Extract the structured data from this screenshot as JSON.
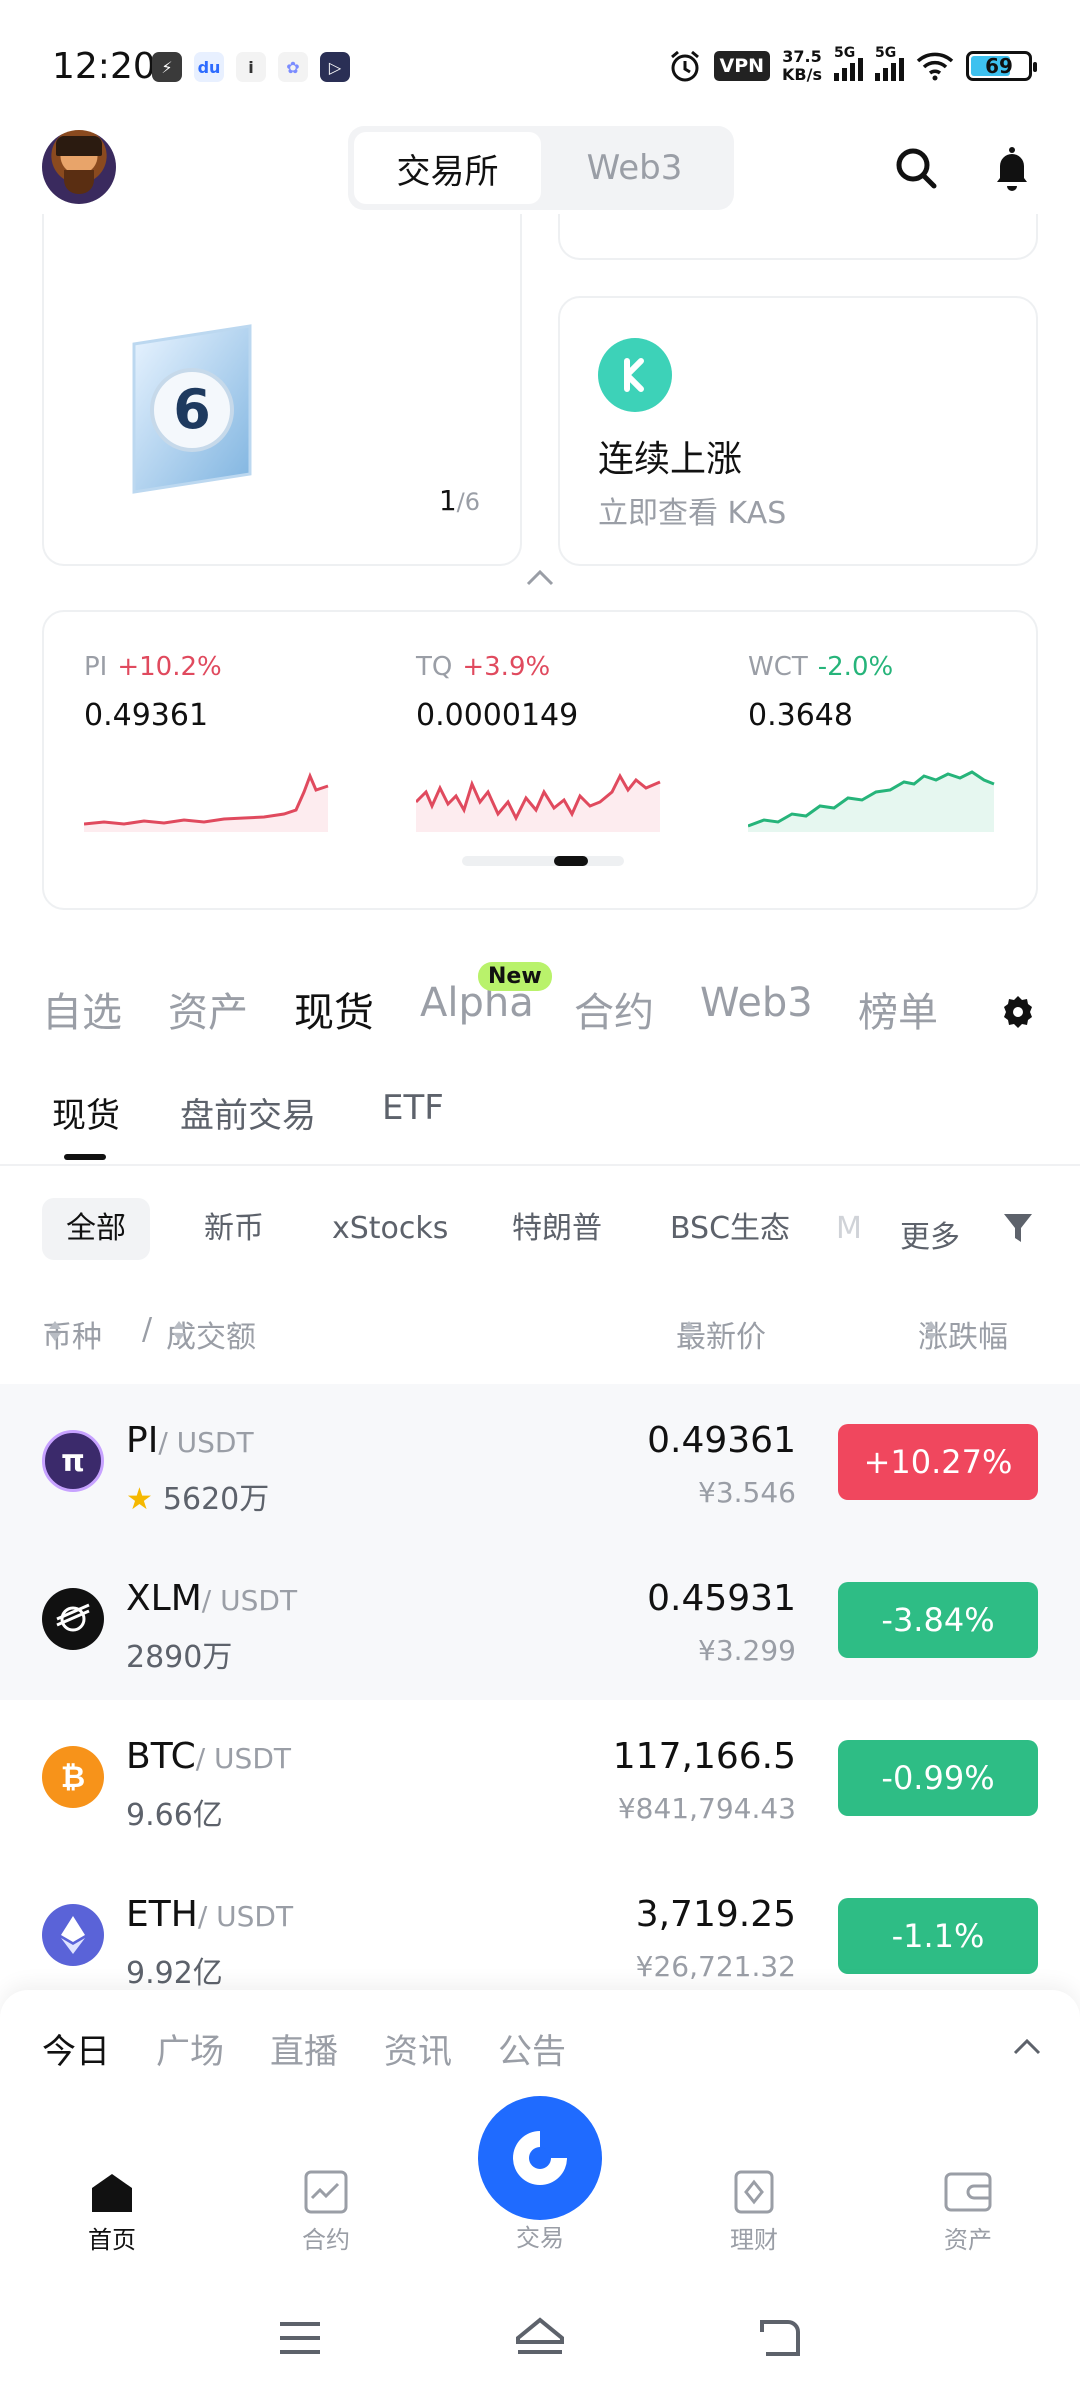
{
  "status": {
    "time": "12:20",
    "vpn": "VPN",
    "speed_value": "37.5",
    "speed_unit": "KB/s",
    "sig1": "5G",
    "sig2": "5G",
    "battery": "69"
  },
  "header": {
    "tabs": [
      "交易所",
      "Web3"
    ],
    "active_tab": "交易所"
  },
  "promo": {
    "pager_current": "1",
    "pager_total": "/6",
    "badge_number": "6",
    "title": "连续上涨",
    "subtitle": "立即查看 KAS"
  },
  "market_cards": [
    {
      "symbol": "PI",
      "change": "+10.2%",
      "price": "0.49361",
      "direction": "up"
    },
    {
      "symbol": "TQ",
      "change": "+3.9%",
      "price": "0.0000149",
      "direction": "up"
    },
    {
      "symbol": "WCT",
      "change": "-2.0%",
      "price": "0.3648",
      "direction": "down"
    }
  ],
  "main_tabs": [
    "自选",
    "资产",
    "现货",
    "Alpha",
    "合约",
    "Web3",
    "榜单"
  ],
  "new_badge": "New",
  "sub_tabs": [
    "现货",
    "盘前交易",
    "ETF"
  ],
  "chips": [
    "全部",
    "新币",
    "xStocks",
    "特朗普",
    "BSC生态",
    "M"
  ],
  "chip_more": "更多",
  "list_header": {
    "coin": "币种",
    "sep": "/",
    "volume": "成交额",
    "last": "最新价",
    "change": "涨跌幅"
  },
  "rows": [
    {
      "symbol": "PI",
      "quote": "/ USDT",
      "volume": "5620万",
      "price": "0.49361",
      "cny": "¥3.546",
      "change": "+10.27%",
      "direction": "up",
      "starred": true,
      "icon_color": "#3b2a6b"
    },
    {
      "symbol": "XLM",
      "quote": "/ USDT",
      "volume": "2890万",
      "price": "0.45931",
      "cny": "¥3.299",
      "change": "-3.84%",
      "direction": "down",
      "starred": false,
      "icon_color": "#111111"
    },
    {
      "symbol": "BTC",
      "quote": "/ USDT",
      "volume": "9.66亿",
      "price": "117,166.5",
      "cny": "¥841,794.43",
      "change": "-0.99%",
      "direction": "down",
      "starred": false,
      "icon_color": "#f7931a"
    },
    {
      "symbol": "ETH",
      "quote": "/ USDT",
      "volume": "9.92亿",
      "price": "3,719.25",
      "cny": "¥26,721.32",
      "change": "-1.1%",
      "direction": "down",
      "starred": false,
      "icon_color": "#5a63d8"
    }
  ],
  "news_tabs": [
    "今日",
    "广场",
    "直播",
    "资讯",
    "公告"
  ],
  "bottom_nav": [
    "首页",
    "合约",
    "交易",
    "理财",
    "资产"
  ],
  "colors": {
    "up": "#f0475e",
    "down": "#2ebd85",
    "accent": "#1f6bff",
    "new_badge": "#b9f26b"
  }
}
